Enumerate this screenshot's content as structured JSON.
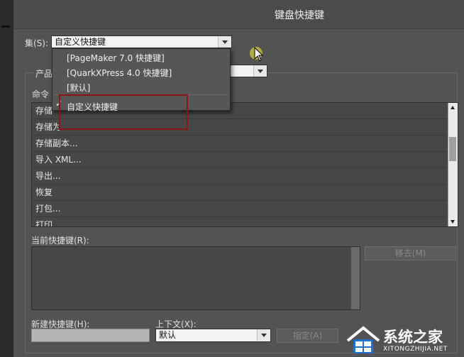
{
  "dialog": {
    "title": "键盘快捷键"
  },
  "set": {
    "label": "集(S):",
    "selected": "自定义快捷键",
    "options": [
      "[PageMaker 7.0 快捷键]",
      "[QuarkXPress 4.0 快捷键]",
      "[默认]",
      "自定义快捷键"
    ],
    "checked_index": 3
  },
  "product_area": {
    "label": "产品"
  },
  "commands": {
    "label": "命令",
    "items": [
      "存储",
      "存储为",
      "存储副本...",
      "导入 XML...",
      "导出...",
      "恢复",
      "打包...",
      "打印..."
    ]
  },
  "current_shortcut": {
    "label": "当前快捷键(R):",
    "remove_label": "移去(M)"
  },
  "new_shortcut": {
    "label": "新建快捷键(H):",
    "value": ""
  },
  "context": {
    "label": "上下文(X):",
    "selected": "默认",
    "assign_label": "指定(A)"
  },
  "watermark": {
    "name": "系统之家",
    "url": "XITONGZHIJIA.NET"
  },
  "colors": {
    "dialog_bg": "#535353",
    "highlight": "#8c1414"
  }
}
